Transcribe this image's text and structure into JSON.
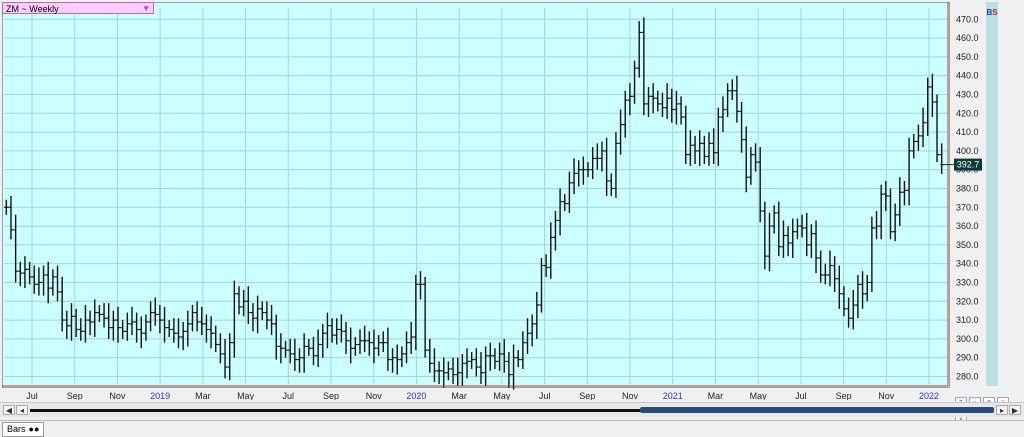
{
  "ticker": {
    "label": "ZM ~ Weekly",
    "dropdown": "▼"
  },
  "last_price_label": "392.7",
  "bs_badge": {
    "b": "B",
    "s": "S"
  },
  "bottom": {
    "tab_label": "Bars",
    "tab_icon": "●●"
  },
  "scroll": {
    "left": "◀",
    "right": "▶",
    "page_left": "◂",
    "page_right": "▸"
  },
  "chart_data": {
    "type": "bar",
    "style": "OHLC",
    "title": "",
    "ylim": [
      276,
      476
    ],
    "yticks": [
      280,
      290,
      300,
      310,
      320,
      330,
      340,
      350,
      360,
      370,
      380,
      390,
      400,
      410,
      420,
      430,
      440,
      450,
      460,
      470
    ],
    "xticks": [
      "Jul",
      "Sep",
      "Nov",
      "2019",
      "Mar",
      "May",
      "Jul",
      "Sep",
      "Nov",
      "2020",
      "Mar",
      "May",
      "Jul",
      "Sep",
      "Nov",
      "2021",
      "Mar",
      "May",
      "Jul",
      "Sep",
      "Nov",
      "2022"
    ],
    "year_ticks": [
      "2019",
      "2020",
      "2021",
      "2022"
    ],
    "closes": [
      370.0,
      358.0,
      336.0,
      335.0,
      337.0,
      333.0,
      329.0,
      330.0,
      334.0,
      327.0,
      333.0,
      325.0,
      310.0,
      307.0,
      312.0,
      305.0,
      304.0,
      310.0,
      309.0,
      314.0,
      313.0,
      311.0,
      306.0,
      310.0,
      306.0,
      304.0,
      308.0,
      309.0,
      305.0,
      303.0,
      309.0,
      314.0,
      313.0,
      310.0,
      306.0,
      305.0,
      303.0,
      301.0,
      304.0,
      308.0,
      314.0,
      309.0,
      308.0,
      305.0,
      303.0,
      297.0,
      292.0,
      285.0,
      298.0,
      324.0,
      317.0,
      320.0,
      314.0,
      311.0,
      316.0,
      314.0,
      310.0,
      308.0,
      296.0,
      295.0,
      294.0,
      292.0,
      289.0,
      290.0,
      296.0,
      295.0,
      291.0,
      297.0,
      303.0,
      307.0,
      302.0,
      305.0,
      304.0,
      299.0,
      295.0,
      297.0,
      299.0,
      299.0,
      298.0,
      295.0,
      298.0,
      298.0,
      289.0,
      290.0,
      289.0,
      292.0,
      298.0,
      301.0,
      329.0,
      329.0,
      294.0,
      287.0,
      283.0,
      283.0,
      282.0,
      284.0,
      281.0,
      282.0,
      287.0,
      288.0,
      289.0,
      285.0,
      282.0,
      291.0,
      291.0,
      288.0,
      292.0,
      288.0,
      281.0,
      290.0,
      289.0,
      298.0,
      303.0,
      308.0,
      318.0,
      339.0,
      338.0,
      354.0,
      363.0,
      373.0,
      372.0,
      383.0,
      388.0,
      390.0,
      390.0,
      390.0,
      396.0,
      396.0,
      400.0,
      384.0,
      380.0,
      404.0,
      414.0,
      427.0,
      429.0,
      444.0,
      463.0,
      425.0,
      429.0,
      428.0,
      425.0,
      423.0,
      428.0,
      422.0,
      425.0,
      418.0,
      398.0,
      403.0,
      400.0,
      404.0,
      397.0,
      404.0,
      399.0,
      418.0,
      422.0,
      432.0,
      432.0,
      421.0,
      406.0,
      386.0,
      398.0,
      394.0,
      368.0,
      344.0,
      360.0,
      367.0,
      349.0,
      355.0,
      351.0,
      357.0,
      360.0,
      359.0,
      350.0,
      356.0,
      343.0,
      334.0,
      334.0,
      339.0,
      332.0,
      324.0,
      316.0,
      311.0,
      318.0,
      329.0,
      324.0,
      330.0,
      359.0,
      360.0,
      377.0,
      376.0,
      357.0,
      366.0,
      378.0,
      379.0,
      400.0,
      405.0,
      408.0,
      415.0,
      434.0,
      426.0,
      398.0,
      392.7
    ]
  }
}
